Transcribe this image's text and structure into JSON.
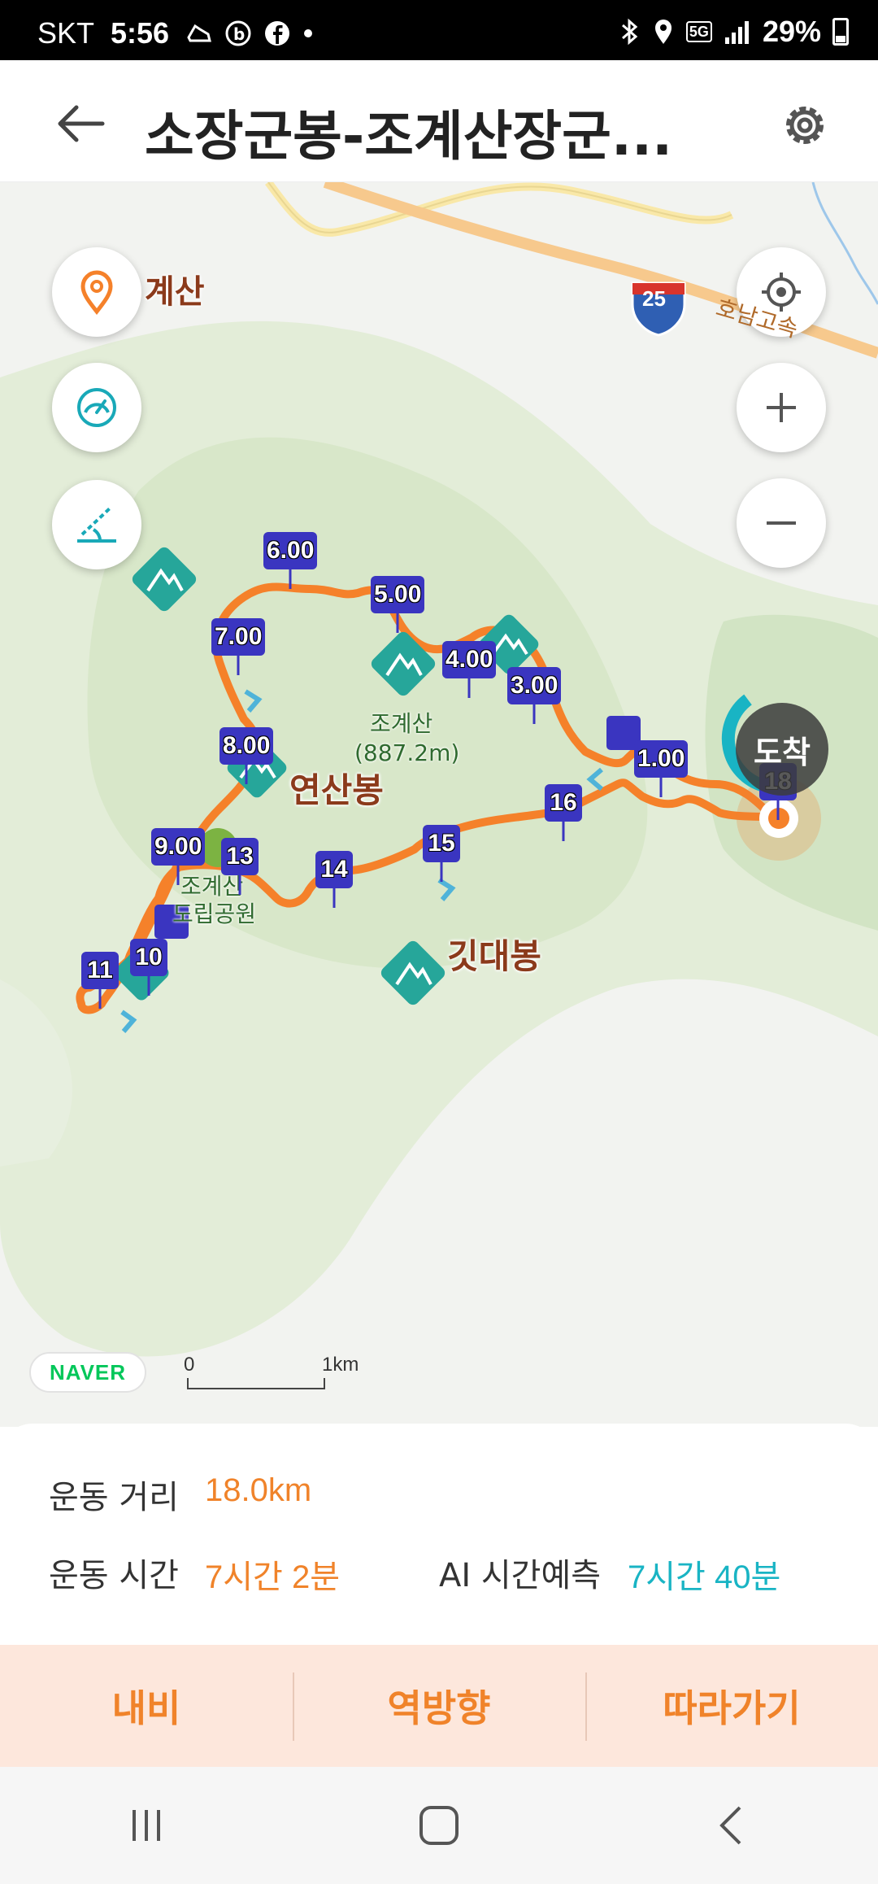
{
  "status_bar": {
    "carrier": "SKT",
    "time": "5:56",
    "network": "5G",
    "battery": "29%"
  },
  "header": {
    "title": "소장군봉-조계산장군..."
  },
  "map": {
    "labels": {
      "top_left_place": "계산",
      "highway_number": "25",
      "highway_name": "호남고속",
      "peak_main": "조계산",
      "peak_main_elevation": "(887.2m)",
      "peak_yeonsan": "연산봉",
      "peak_gitdae": "깃대봉",
      "park_name_line1": "조계산",
      "park_name_line2": "도립공원"
    },
    "km_markers": [
      "1.00",
      "3.00",
      "4.00",
      "5.00",
      "6.00",
      "7.00",
      "8.00",
      "9.00",
      "10",
      "11",
      "13",
      "14",
      "15",
      "16",
      "18"
    ],
    "arrival_badge": "도착",
    "brand": "NAVER",
    "scale": {
      "start": "0",
      "end": "1km"
    }
  },
  "stats": {
    "distance_label": "운동 거리",
    "distance_value": "18.0km",
    "time_label": "운동 시간",
    "time_value": "7시간 2분",
    "ai_label": "AI 시간예측",
    "ai_value": "7시간 40분"
  },
  "actions": {
    "nav": "내비",
    "reverse": "역방향",
    "follow": "따라가기"
  },
  "colors": {
    "route": "#f5812a",
    "accent_orange": "#f0832a",
    "ai_teal": "#19b4c4",
    "marker_blue": "#3a35c0",
    "action_bar_bg": "#fde7dc"
  }
}
